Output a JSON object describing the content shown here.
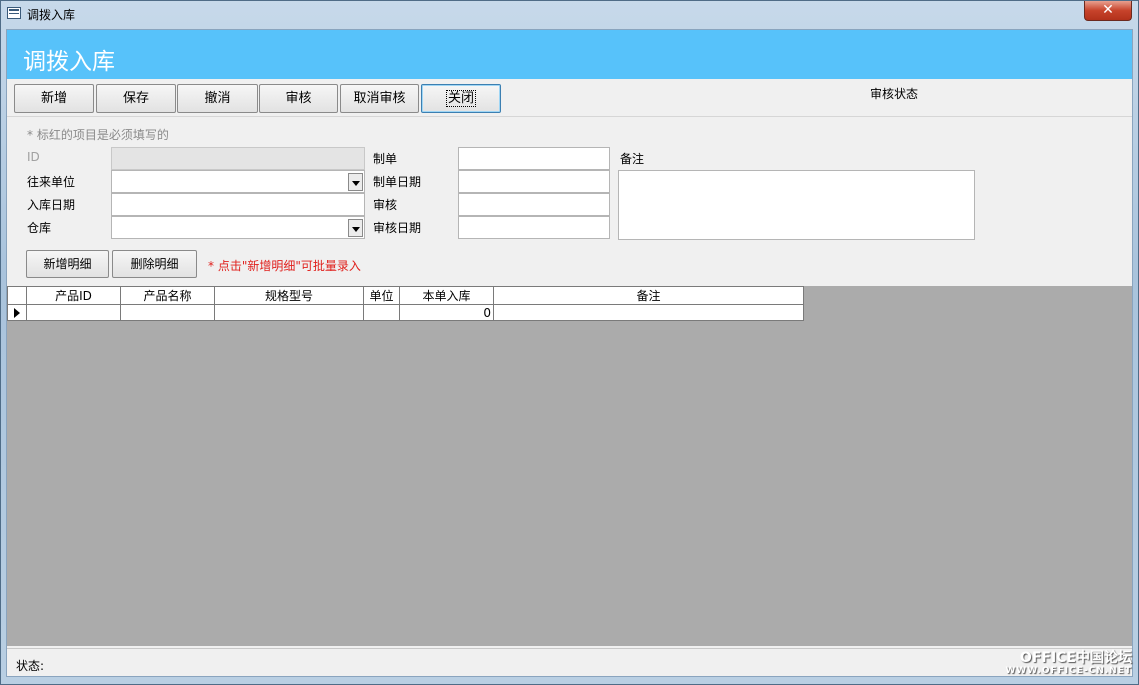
{
  "window": {
    "title": "调拨入库",
    "close_glyph": "✕"
  },
  "form": {
    "title": "调拨入库"
  },
  "toolbar": {
    "buttons": [
      "新增",
      "保存",
      "撤消",
      "审核",
      "取消审核",
      "关闭"
    ],
    "audit_status_label": "审核状态"
  },
  "detail": {
    "hint": "* 标红的项目是必须填写的",
    "labels": {
      "id": "ID",
      "partner": "往来单位",
      "inbound_date": "入库日期",
      "warehouse": "仓库",
      "maker": "制单",
      "make_date": "制单日期",
      "auditor": "审核",
      "audit_date": "审核日期",
      "remark": "备注"
    },
    "add_detail_button": "新增明细",
    "delete_detail_button": "删除明细",
    "batch_hint": "* 点击\"新增明细\"可批量录入"
  },
  "grid": {
    "columns": [
      "产品ID",
      "产品名称",
      "规格型号",
      "单位",
      "本单入库",
      "备注"
    ],
    "rows": [
      [
        "",
        "",
        "",
        "",
        "0",
        ""
      ]
    ]
  },
  "statusbar": {
    "label": "状态:"
  },
  "watermark": {
    "line1": "OFFICE中国论坛",
    "line2": "WWW.OFFICE-CN.NET"
  }
}
